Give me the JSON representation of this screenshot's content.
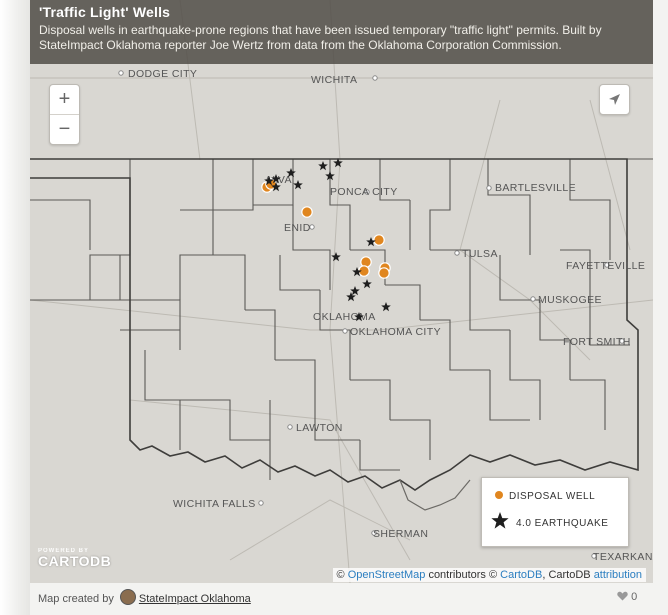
{
  "header": {
    "title": "'Traffic Light' Wells",
    "description": "Disposal wells in earthquake-prone regions that have been issued temporary \"traffic light\" permits. Built by StateImpact Oklahoma reporter Joe Wertz from data from the Oklahoma Corporation Commission."
  },
  "controls": {
    "zoom_in": "+",
    "zoom_out": "−"
  },
  "map": {
    "cities": [
      "DODGE CITY",
      "WICHITA",
      "ENID",
      "PONCA CITY",
      "BARTLESVILLE",
      "TULSA",
      "FAYETTEVILLE",
      "MUSKOGEE",
      "OKLAHOMA",
      "OKLAHOMA CITY",
      "FORT SMITH",
      "LAWTON",
      "WICHITA FALLS",
      "SHERMAN",
      "TEXARKANA",
      "ALVA"
    ],
    "colors": {
      "disposal_well": "#e0861f",
      "earthquake": "#1e1e1e",
      "land": "#d9d7d2",
      "boundary": "#4a4a4a"
    }
  },
  "legend": {
    "disposal_label": "DISPOSAL WELL",
    "earthquake_label": "4.0 EARTHQUAKE"
  },
  "attribution": {
    "copy1": "©",
    "osm": "OpenStreetMap",
    "contrib": "contributors ©",
    "cartodb": "CartoDB",
    "copy2": ", CartoDB",
    "attribution": "attribution"
  },
  "branding": {
    "powered_by": "POWERED BY",
    "name": "CARTODB"
  },
  "footer": {
    "created_by": "Map created by",
    "author": "StateImpact Oklahoma",
    "likes": "0"
  }
}
